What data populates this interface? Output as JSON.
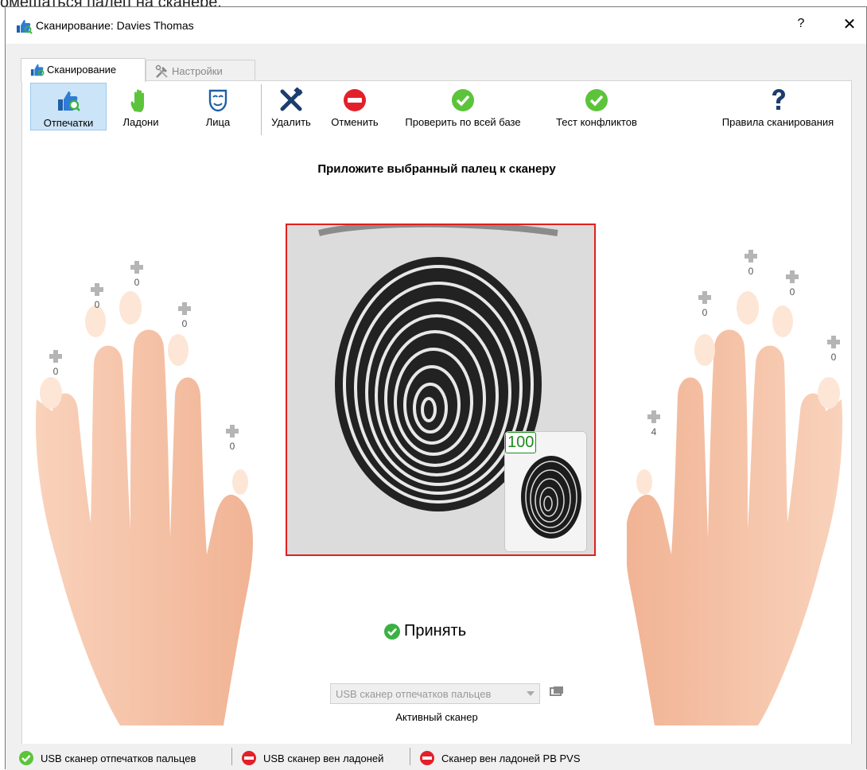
{
  "overlay_caption": "омещаться палец на сканере.",
  "window": {
    "title": "Сканирование: Davies Thomas",
    "help": "?",
    "close": "✕"
  },
  "tabs": [
    {
      "label": "Сканирование",
      "active": true
    },
    {
      "label": "Настройки",
      "active": false
    }
  ],
  "toolbar": {
    "fingerprints": "Отпечатки",
    "palms": "Ладони",
    "faces": "Лица",
    "delete": "Удалить",
    "cancel": "Отменить",
    "verify_db": "Проверить по всей базе",
    "conflict_test": "Тест конфликтов",
    "rules": "Правила сканирования"
  },
  "instruction": "Приложите выбранный палец к сканеру",
  "left_hand_counts": [
    "0",
    "0",
    "0",
    "0",
    "0"
  ],
  "right_hand_counts": [
    "0",
    "0",
    "0",
    "0",
    "4"
  ],
  "quality_score": "100",
  "accept_label": "Принять",
  "scanner": {
    "selected": "USB сканер отпечатков пальцев",
    "label": "Активный сканер"
  },
  "status": [
    {
      "label": "USB сканер отпечатков пальцев",
      "state": "ok"
    },
    {
      "label": "USB сканер вен ладоней",
      "state": "error"
    },
    {
      "label": "Сканер вен ладоней PB PVS",
      "state": "error"
    }
  ],
  "colors": {
    "ok": "#3cb043",
    "error": "#e3202a",
    "accent": "#1e5fa8",
    "skin": "#f6c4a8",
    "frame": "#e02020"
  }
}
